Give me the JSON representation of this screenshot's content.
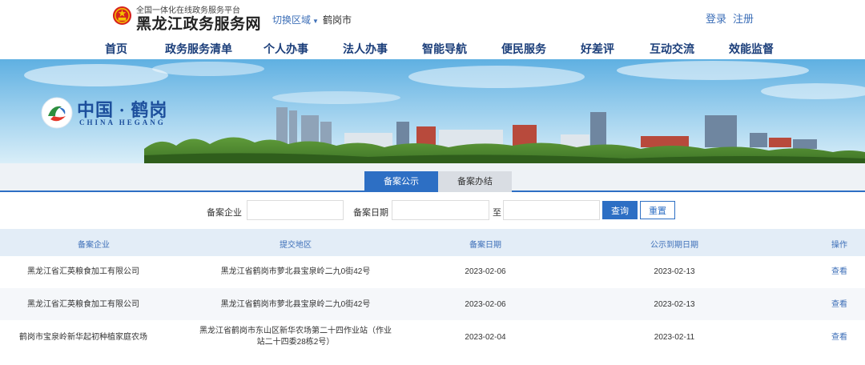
{
  "header": {
    "platform_subtitle": "全国一体化在线政务服务平台",
    "site_title": "黑龙江政务服务网",
    "region_switch_label": "切换区域",
    "current_city": "鹤岗市",
    "login_label": "登录",
    "register_label": "注册"
  },
  "nav": {
    "items": [
      {
        "label": "首页"
      },
      {
        "label": "政务服务清单"
      },
      {
        "label": "个人办事"
      },
      {
        "label": "法人办事"
      },
      {
        "label": "智能导航"
      },
      {
        "label": "便民服务"
      },
      {
        "label": "好差评"
      },
      {
        "label": "互动交流"
      },
      {
        "label": "效能监督"
      }
    ]
  },
  "banner": {
    "title_cn": "中国 · 鹤岗",
    "title_en": "CHINA  HEGANG"
  },
  "tabs": [
    {
      "label": "备案公示",
      "active": true
    },
    {
      "label": "备案办结",
      "active": false
    }
  ],
  "filter": {
    "company_label": "备案企业",
    "company_value": "",
    "date_label": "备案日期",
    "date_from_value": "",
    "date_to_separator": "至",
    "date_to_value": "",
    "query_label": "查询",
    "reset_label": "重置"
  },
  "table": {
    "columns": [
      "备案企业",
      "提交地区",
      "备案日期",
      "公示到期日期",
      "操作"
    ],
    "rows": [
      {
        "company": "黑龙江省汇英粮食加工有限公司",
        "region": "黑龙江省鹤岗市萝北县宝泉岭二九0街42号",
        "filing_date": "2023-02-06",
        "expiry_date": "2023-02-13",
        "action": "查看"
      },
      {
        "company": "黑龙江省汇英粮食加工有限公司",
        "region": "黑龙江省鹤岗市萝北县宝泉岭二九0街42号",
        "filing_date": "2023-02-06",
        "expiry_date": "2023-02-13",
        "action": "查看"
      },
      {
        "company": "鹤岗市宝泉岭新华起初种植家庭农场",
        "region": "黑龙江省鹤岗市东山区新华农场第二十四作业站（作业站二十四委28栋2号）",
        "filing_date": "2023-02-04",
        "expiry_date": "2023-02-11",
        "action": "查看"
      }
    ]
  },
  "colors": {
    "primary_blue": "#2d6fc4",
    "nav_text": "#1b3e7a",
    "link_blue": "#3d6fb8",
    "table_header_bg": "#e3edf7"
  }
}
